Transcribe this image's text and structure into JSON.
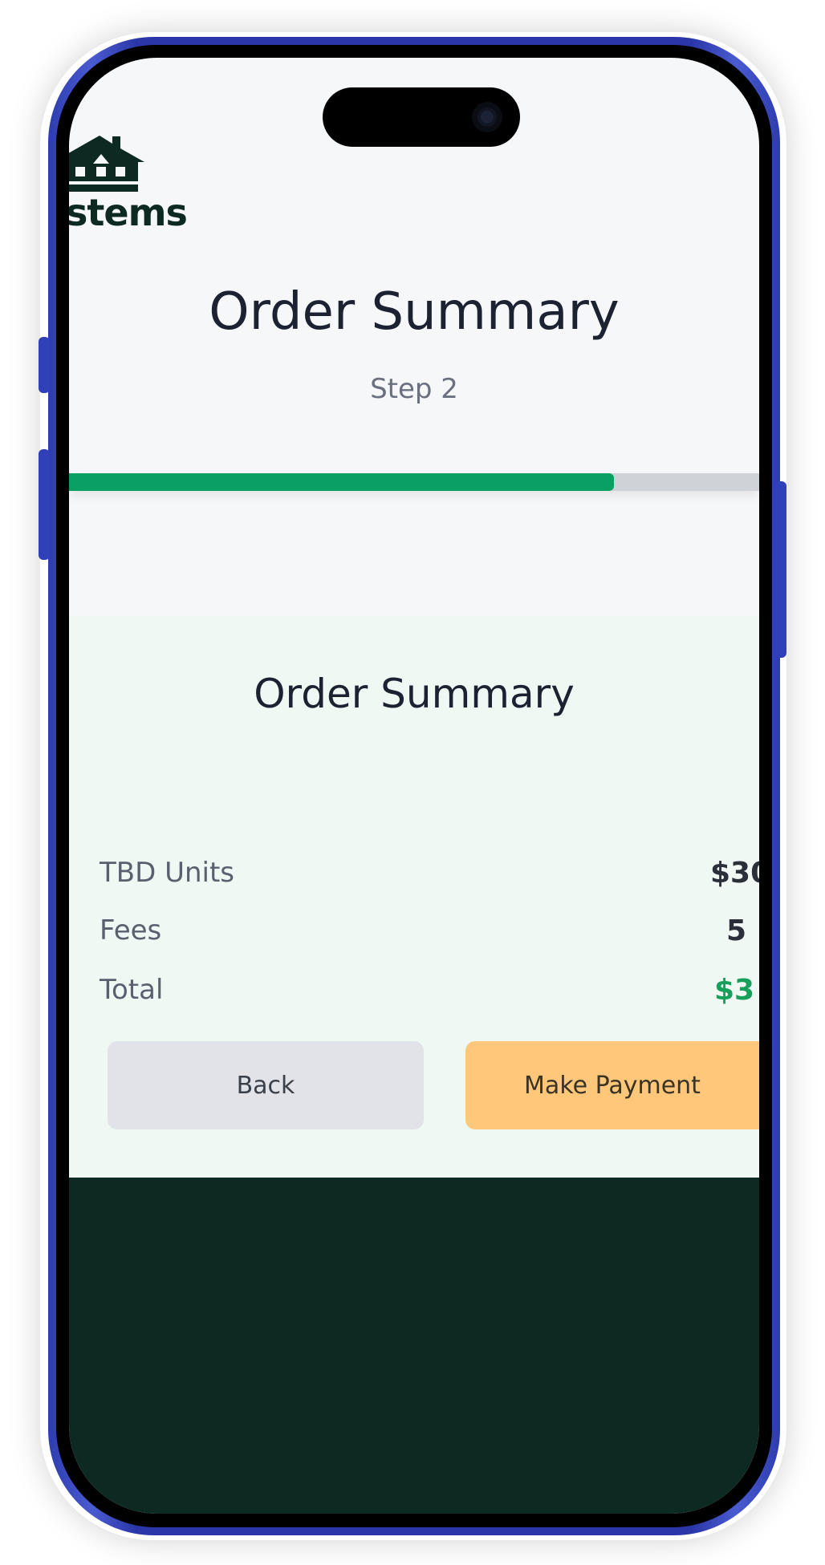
{
  "brand": {
    "logo_text": "stems",
    "icon": "house-logo-icon"
  },
  "header": {
    "title": "Order Summary",
    "step": "Step 2",
    "progress": 0.79
  },
  "summary": {
    "title": "Order Summary",
    "rows": [
      {
        "label": "TBD Units",
        "value": "$30"
      },
      {
        "label": "Fees",
        "value": "5"
      },
      {
        "label": "Total",
        "value": "$3"
      }
    ]
  },
  "actions": {
    "back_label": "Back",
    "pay_label": "Make Payment"
  },
  "colors": {
    "accent_green": "#0aa063",
    "total_green": "#18a05a",
    "pay_button": "#fec77a",
    "footer": "#0d2a22",
    "phone_frame": "#2b37a8"
  }
}
